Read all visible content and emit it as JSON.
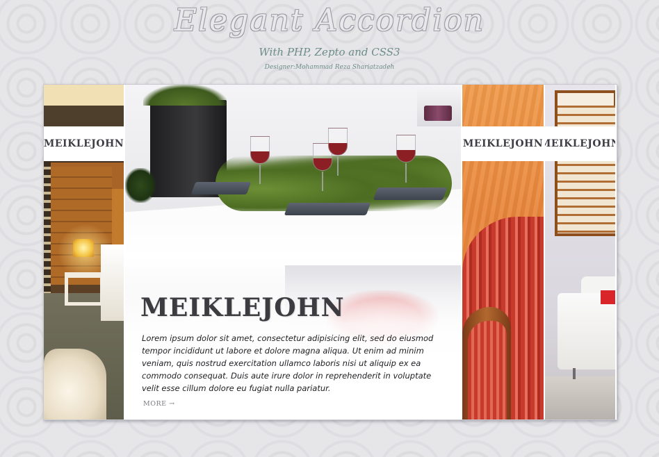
{
  "header": {
    "title": "Elegant Accordion",
    "subtitle": "With PHP, Zepto and CSS3",
    "credit": "Designer:Mohammad Reza Shariatzadeh"
  },
  "accordion": {
    "slides": [
      {
        "label": "MEIKLEJOHN",
        "state": "collapsed"
      },
      {
        "label": "MEIKLEJOHN",
        "state": "expanded",
        "heading": "MEIKLEJOHN",
        "body": "Lorem ipsum dolor sit amet, consectetur adipisicing elit, sed do eiusmod tempor incididunt ut labore et dolore magna aliqua. Ut enim ad minim veniam, quis nostrud exercitation ullamco laboris nisi ut aliquip ex ea commodo consequat. Duis aute irure dolor in reprehenderit in voluptate velit esse cillum dolore eu fugiat nulla pariatur.",
        "more": "MORE →"
      },
      {
        "label": "MEIKLEJOHN",
        "state": "collapsed"
      },
      {
        "label": "MEIKLEJOHN",
        "state": "collapsed"
      }
    ]
  },
  "colors": {
    "background": "#e6e6e8",
    "title_outline": "#9c9ca6",
    "subtitle": "#6d8c86",
    "label_text": "#3e3e44",
    "body_text": "#1e1e22"
  }
}
